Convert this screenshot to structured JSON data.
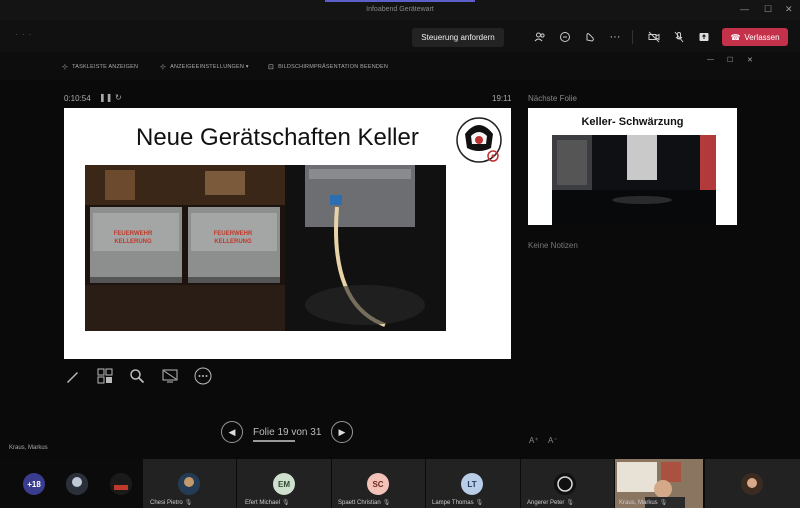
{
  "window": {
    "title": "Infoabend Gerätewart",
    "minimize": "—",
    "maximize": "☐",
    "close": "✕"
  },
  "meeting": {
    "request_control_label": "Steuerung anfordern",
    "leave_label": "Verlassen",
    "left_dots": "· · ·"
  },
  "presenter_toolbar": {
    "taskbar_label": "TASKLEISTE ANZEIGEN",
    "display_settings_label": "ANZEIGEEINSTELLUNGEN ▾",
    "end_show_label": "BILDSCHIRMPRÄSENTATION BEENDEN",
    "minimize": "—",
    "restore": "☐",
    "close": "✕"
  },
  "presenter_view": {
    "timer": "0:10:54",
    "clock": "19:11",
    "next_slide_label": "Nächste Folie",
    "no_notes_label": "Keine Notizen",
    "slide_counter": "Folie 19 von 31",
    "text_size_up": "A⁺",
    "text_size_down": "A⁻",
    "presenter_name": "Kraus, Markus"
  },
  "current_slide": {
    "title": "Neue Gerätschaften Keller",
    "photo1_label_a": "FEUERWEHR\nKELLERUNG",
    "photo1_label_b": "FEUERWEHR\nKELLERUNG"
  },
  "next_slide": {
    "title": "Keller- Schwärzung"
  },
  "participants": {
    "more_count": "+18",
    "people": [
      {
        "name": "Chesi Pietro",
        "initials": "",
        "color": ""
      },
      {
        "name": "Efert Michael",
        "initials": "EM",
        "color": "#cfe0cf"
      },
      {
        "name": "Spaett Christian",
        "initials": "SC",
        "color": "#f3c2b8"
      },
      {
        "name": "Lampe Thomas",
        "initials": "LT",
        "color": "#b9cde8"
      },
      {
        "name": "Angerer Peter",
        "initials": "",
        "color": ""
      },
      {
        "name": "Kraus, Markus",
        "initials": "",
        "color": ""
      }
    ]
  },
  "colors": {
    "accent": "#5b5fc7",
    "leave": "#c4314b",
    "more_badge": "#3a3d8f"
  }
}
